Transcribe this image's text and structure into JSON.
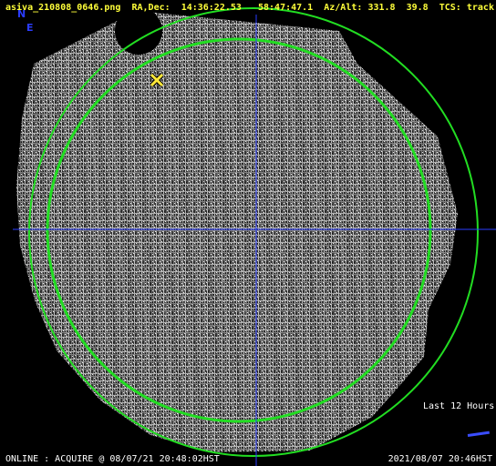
{
  "header": {
    "filename": "asiva_210808_0646.png",
    "radec_label": "RA,Dec:",
    "ra": "14:36:22.53",
    "dec": "58:47:47.1",
    "azalt_label": "Az/Alt:",
    "az": "331.8",
    "alt": "39.8",
    "tcs_label": "TCS:",
    "tcs_state": "track"
  },
  "compass": {
    "north": "N",
    "east": "E"
  },
  "legend": {
    "label": "Last 12 Hours",
    "track_color": "#3a4dff"
  },
  "footer": {
    "status": "ONLINE : ACQUIRE @ 08/07/21 20:48:02HST",
    "timestamp": "2021/08/07 20:46HST"
  },
  "colors": {
    "header_text": "#ffff3a",
    "circle": "#22dd22",
    "crosshair": "#2a3cff",
    "target_marker": "#ffe83a",
    "compass": "#2a3cff"
  },
  "icons": {
    "target": "x-mark-icon"
  }
}
